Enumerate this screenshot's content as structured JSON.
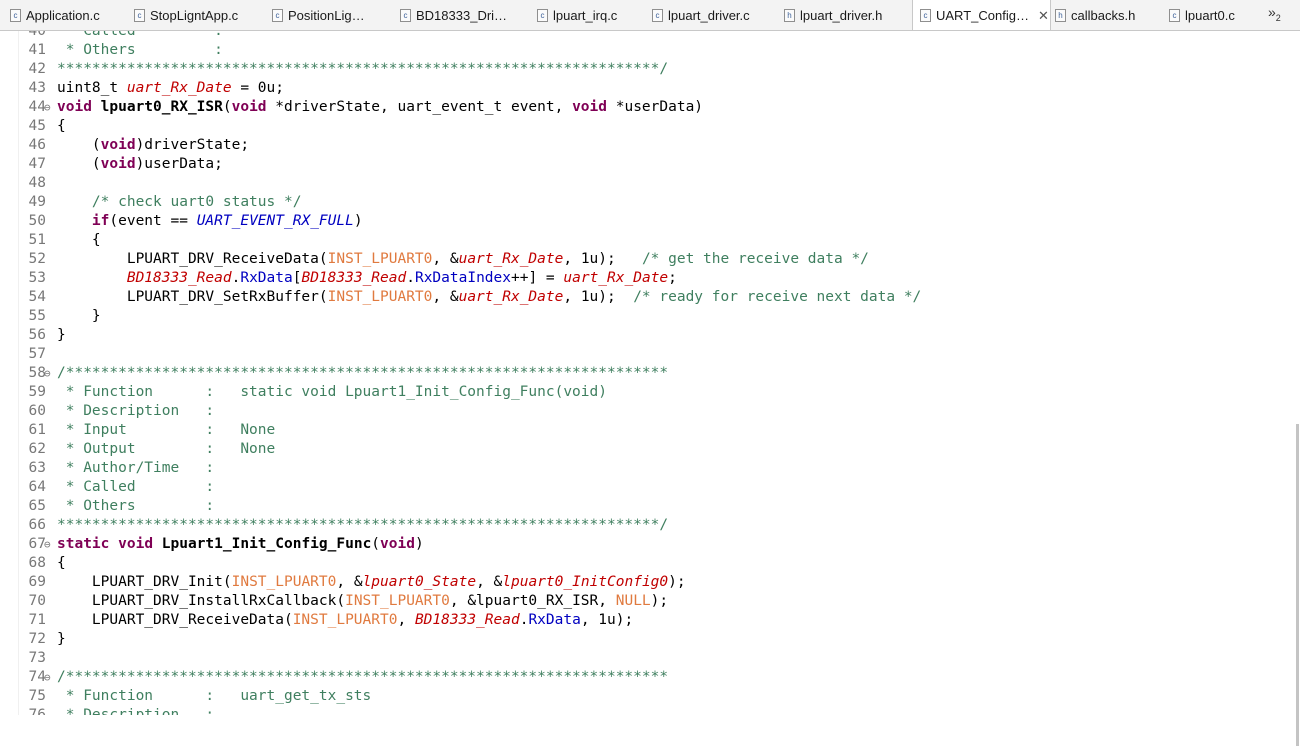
{
  "tabs": [
    {
      "label": "Application.c",
      "icon": "c-file-icon",
      "active": false
    },
    {
      "label": "StopLigntApp.c",
      "icon": "c-file-icon",
      "active": false
    },
    {
      "label": "PositionLig…",
      "icon": "c-file-icon",
      "active": false
    },
    {
      "label": "BD18333_Dri…",
      "icon": "c-file-icon",
      "active": false
    },
    {
      "label": "lpuart_irq.c",
      "icon": "c-file-icon",
      "active": false
    },
    {
      "label": "lpuart_driver.c",
      "icon": "c-file-icon",
      "active": false
    },
    {
      "label": "lpuart_driver.h",
      "icon": "h-file-icon",
      "active": false
    },
    {
      "label": "UART_Config…",
      "icon": "c-file-icon",
      "active": true
    },
    {
      "label": "callbacks.h",
      "icon": "h-file-icon",
      "active": false
    },
    {
      "label": "lpuart0.c",
      "icon": "c-file-icon",
      "active": false
    }
  ],
  "tab_close_glyph": "✕",
  "tab_overflow": {
    "glyph": "»",
    "count": "2"
  },
  "lines": [
    {
      "n": "40",
      "fold": "",
      "tokens": [
        {
          "t": "c",
          "v": " * Called         :"
        }
      ]
    },
    {
      "n": "41",
      "fold": "",
      "tokens": [
        {
          "t": "c",
          "v": " * Others         :"
        }
      ]
    },
    {
      "n": "42",
      "fold": "",
      "tokens": [
        {
          "t": "c",
          "v": "*********************************************************************/"
        }
      ]
    },
    {
      "n": "43",
      "fold": "",
      "tokens": [
        {
          "t": "p",
          "v": "uint8_t "
        },
        {
          "t": "g",
          "v": "uart_Rx_Date"
        },
        {
          "t": "p",
          "v": " = 0u;"
        }
      ]
    },
    {
      "n": "44",
      "fold": "⊖",
      "tokens": [
        {
          "t": "k",
          "v": "void"
        },
        {
          "t": "p",
          "v": " "
        },
        {
          "t": "f",
          "v": "lpuart0_RX_ISR"
        },
        {
          "t": "p",
          "v": "("
        },
        {
          "t": "k",
          "v": "void"
        },
        {
          "t": "p",
          "v": " *driverState, uart_event_t event, "
        },
        {
          "t": "k",
          "v": "void"
        },
        {
          "t": "p",
          "v": " *userData)"
        }
      ]
    },
    {
      "n": "45",
      "fold": "",
      "tokens": [
        {
          "t": "p",
          "v": "{"
        }
      ]
    },
    {
      "n": "46",
      "fold": "",
      "tokens": [
        {
          "t": "p",
          "v": "    ("
        },
        {
          "t": "k",
          "v": "void"
        },
        {
          "t": "p",
          "v": ")driverState;"
        }
      ]
    },
    {
      "n": "47",
      "fold": "",
      "tokens": [
        {
          "t": "p",
          "v": "    ("
        },
        {
          "t": "k",
          "v": "void"
        },
        {
          "t": "p",
          "v": ")userData;"
        }
      ]
    },
    {
      "n": "48",
      "fold": "",
      "tokens": []
    },
    {
      "n": "49",
      "fold": "",
      "tokens": [
        {
          "t": "p",
          "v": "    "
        },
        {
          "t": "c",
          "v": "/* check uart0 status */"
        }
      ]
    },
    {
      "n": "50",
      "fold": "",
      "tokens": [
        {
          "t": "p",
          "v": "    "
        },
        {
          "t": "k",
          "v": "if"
        },
        {
          "t": "p",
          "v": "(event == "
        },
        {
          "t": "e",
          "v": "UART_EVENT_RX_FULL"
        },
        {
          "t": "p",
          "v": ")"
        }
      ]
    },
    {
      "n": "51",
      "fold": "",
      "tokens": [
        {
          "t": "p",
          "v": "    {"
        }
      ]
    },
    {
      "n": "52",
      "fold": "",
      "tokens": [
        {
          "t": "p",
          "v": "        LPUART_DRV_ReceiveData("
        },
        {
          "t": "m",
          "v": "INST_LPUART0"
        },
        {
          "t": "p",
          "v": ", &"
        },
        {
          "t": "g",
          "v": "uart_Rx_Date"
        },
        {
          "t": "p",
          "v": ", 1u);   "
        },
        {
          "t": "c",
          "v": "/* get the receive data */"
        }
      ]
    },
    {
      "n": "53",
      "fold": "",
      "tokens": [
        {
          "t": "p",
          "v": "        "
        },
        {
          "t": "g",
          "v": "BD18333_Read"
        },
        {
          "t": "p",
          "v": "."
        },
        {
          "t": "d",
          "v": "RxData"
        },
        {
          "t": "p",
          "v": "["
        },
        {
          "t": "g",
          "v": "BD18333_Read"
        },
        {
          "t": "p",
          "v": "."
        },
        {
          "t": "d",
          "v": "RxDataIndex"
        },
        {
          "t": "p",
          "v": "++] = "
        },
        {
          "t": "g",
          "v": "uart_Rx_Date"
        },
        {
          "t": "p",
          "v": ";"
        }
      ]
    },
    {
      "n": "54",
      "fold": "",
      "tokens": [
        {
          "t": "p",
          "v": "        LPUART_DRV_SetRxBuffer("
        },
        {
          "t": "m",
          "v": "INST_LPUART0"
        },
        {
          "t": "p",
          "v": ", &"
        },
        {
          "t": "g",
          "v": "uart_Rx_Date"
        },
        {
          "t": "p",
          "v": ", 1u);  "
        },
        {
          "t": "c",
          "v": "/* ready for receive next data */"
        }
      ]
    },
    {
      "n": "55",
      "fold": "",
      "tokens": [
        {
          "t": "p",
          "v": "    }"
        }
      ]
    },
    {
      "n": "56",
      "fold": "",
      "tokens": [
        {
          "t": "p",
          "v": "}"
        }
      ]
    },
    {
      "n": "57",
      "fold": "",
      "tokens": []
    },
    {
      "n": "58",
      "fold": "⊖",
      "tokens": [
        {
          "t": "c",
          "v": "/*********************************************************************"
        }
      ]
    },
    {
      "n": "59",
      "fold": "",
      "tokens": [
        {
          "t": "c",
          "v": " * Function      :   static void Lpuart1_Init_Config_Func(void)"
        }
      ]
    },
    {
      "n": "60",
      "fold": "",
      "tokens": [
        {
          "t": "c",
          "v": " * Description   :"
        }
      ]
    },
    {
      "n": "61",
      "fold": "",
      "tokens": [
        {
          "t": "c",
          "v": " * Input         :   None"
        }
      ]
    },
    {
      "n": "62",
      "fold": "",
      "tokens": [
        {
          "t": "c",
          "v": " * Output        :   None"
        }
      ]
    },
    {
      "n": "63",
      "fold": "",
      "tokens": [
        {
          "t": "c",
          "v": " * Author/Time   :"
        }
      ]
    },
    {
      "n": "64",
      "fold": "",
      "tokens": [
        {
          "t": "c",
          "v": " * Called        :"
        }
      ]
    },
    {
      "n": "65",
      "fold": "",
      "tokens": [
        {
          "t": "c",
          "v": " * Others        :"
        }
      ]
    },
    {
      "n": "66",
      "fold": "",
      "tokens": [
        {
          "t": "c",
          "v": "*********************************************************************/"
        }
      ]
    },
    {
      "n": "67",
      "fold": "⊖",
      "tokens": [
        {
          "t": "k",
          "v": "static"
        },
        {
          "t": "p",
          "v": " "
        },
        {
          "t": "k",
          "v": "void"
        },
        {
          "t": "p",
          "v": " "
        },
        {
          "t": "f",
          "v": "Lpuart1_Init_Config_Func"
        },
        {
          "t": "p",
          "v": "("
        },
        {
          "t": "k",
          "v": "void"
        },
        {
          "t": "p",
          "v": ")"
        }
      ]
    },
    {
      "n": "68",
      "fold": "",
      "tokens": [
        {
          "t": "p",
          "v": "{"
        }
      ]
    },
    {
      "n": "69",
      "fold": "",
      "tokens": [
        {
          "t": "p",
          "v": "    LPUART_DRV_Init("
        },
        {
          "t": "m",
          "v": "INST_LPUART0"
        },
        {
          "t": "p",
          "v": ", &"
        },
        {
          "t": "g",
          "v": "lpuart0_State"
        },
        {
          "t": "p",
          "v": ", &"
        },
        {
          "t": "g",
          "v": "lpuart0_InitConfig0"
        },
        {
          "t": "p",
          "v": ");"
        }
      ]
    },
    {
      "n": "70",
      "fold": "",
      "tokens": [
        {
          "t": "p",
          "v": "    LPUART_DRV_InstallRxCallback("
        },
        {
          "t": "m",
          "v": "INST_LPUART0"
        },
        {
          "t": "p",
          "v": ", &lpuart0_RX_ISR, "
        },
        {
          "t": "m",
          "v": "NULL"
        },
        {
          "t": "p",
          "v": ");"
        }
      ]
    },
    {
      "n": "71",
      "fold": "",
      "tokens": [
        {
          "t": "p",
          "v": "    LPUART_DRV_ReceiveData("
        },
        {
          "t": "m",
          "v": "INST_LPUART0"
        },
        {
          "t": "p",
          "v": ", "
        },
        {
          "t": "g",
          "v": "BD18333_Read"
        },
        {
          "t": "p",
          "v": "."
        },
        {
          "t": "d",
          "v": "RxData"
        },
        {
          "t": "p",
          "v": ", 1u);"
        }
      ]
    },
    {
      "n": "72",
      "fold": "",
      "tokens": [
        {
          "t": "p",
          "v": "}"
        }
      ]
    },
    {
      "n": "73",
      "fold": "",
      "tokens": []
    },
    {
      "n": "74",
      "fold": "⊖",
      "tokens": [
        {
          "t": "c",
          "v": "/*********************************************************************"
        }
      ]
    },
    {
      "n": "75",
      "fold": "",
      "tokens": [
        {
          "t": "c",
          "v": " * Function      :   uart_get_tx_sts"
        }
      ]
    },
    {
      "n": "76",
      "fold": "",
      "tokens": [
        {
          "t": "c",
          "v": " * Description   :"
        }
      ]
    }
  ]
}
